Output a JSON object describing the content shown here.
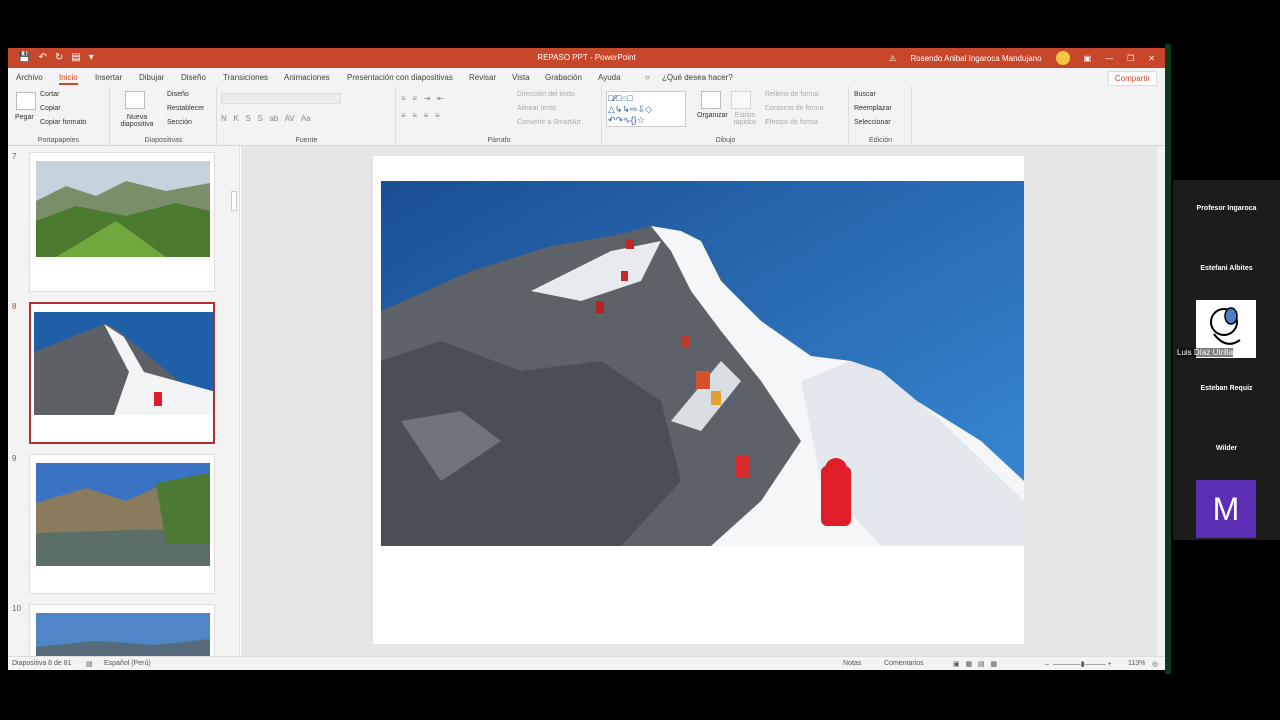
{
  "window": {
    "title": "REPASO PPT  -  PowerPoint",
    "user": "Rosendo Anibal Ingaroca Mandujano"
  },
  "menu": {
    "tabs": [
      "Archivo",
      "Inicio",
      "Insertar",
      "Dibujar",
      "Diseño",
      "Transiciones",
      "Animaciones",
      "Presentación con diapositivas",
      "Revisar",
      "Vista",
      "Grabación",
      "Ayuda"
    ],
    "active": "Inicio",
    "tell_me": "¿Qué desea hacer?",
    "share": "Compartir"
  },
  "ribbon": {
    "clipboard": {
      "label": "Portapapeles",
      "paste": "Pegar",
      "cut": "Cortar",
      "copy": "Copiar",
      "format_painter": "Copiar formato"
    },
    "slides": {
      "label": "Diapositivas",
      "new_slide": "Nueva diapositiva",
      "layout": "Diseño",
      "reset": "Restablecer",
      "section": "Sección"
    },
    "font": {
      "label": "Fuente"
    },
    "paragraph": {
      "label": "Párrafo",
      "text_direction": "Dirección del texto",
      "align_text": "Alinear texto",
      "smartart": "Convertir a SmartArt"
    },
    "drawing": {
      "label": "Dibujo",
      "arrange": "Organizar",
      "quick_styles": "Estilos rápidos",
      "fill": "Relleno de forma",
      "outline": "Contorno de forma",
      "effects": "Efectos de forma"
    },
    "editing": {
      "label": "Edición",
      "find": "Buscar",
      "replace": "Reemplazar",
      "select": "Seleccionar"
    }
  },
  "thumbnails": [
    {
      "number": "7"
    },
    {
      "number": "8",
      "active": true
    },
    {
      "number": "9"
    },
    {
      "number": "10"
    }
  ],
  "status": {
    "slide_info": "Diapositiva 8 de 81",
    "language": "Español (Perú)",
    "notes": "Notas",
    "comments": "Comentarios",
    "zoom": "113%"
  },
  "meeting": {
    "participants": [
      "Profesor Ingaroca",
      "Estefani Albites",
      "Luis Díaz Utrilla",
      "Esteban Requiz",
      "Wilder"
    ],
    "avatar_letter": "M",
    "avatar_color": "#5b2fb3"
  }
}
